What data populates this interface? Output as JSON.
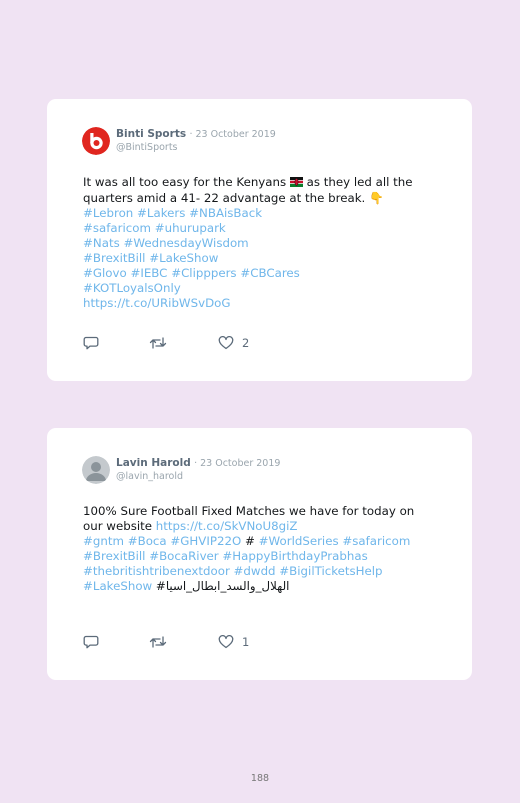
{
  "tweets": [
    {
      "display_name": "Binti Sports",
      "date": "· 23 October 2019",
      "handle": "@BintiSports",
      "avatar_color": "#e0261f",
      "lines": [
        [
          {
            "t": "It was all too easy for the Kenyans "
          },
          {
            "t": "🇰🇪",
            "flag": true
          },
          {
            "t": " as they led all the"
          }
        ],
        [
          {
            "t": "quarters amid a 41- 22 advantage at the break. "
          },
          {
            "t": "👇",
            "emoji": true
          }
        ],
        [
          {
            "t": "#Lebron",
            "link": true
          },
          {
            "t": " "
          },
          {
            "t": "#Lakers",
            "link": true
          },
          {
            "t": " "
          },
          {
            "t": "#NBAisBack",
            "link": true
          }
        ],
        [
          {
            "t": "#safaricom",
            "link": true
          },
          {
            "t": " "
          },
          {
            "t": "#uhurupark",
            "link": true
          }
        ],
        [
          {
            "t": "#Nats",
            "link": true
          },
          {
            "t": " "
          },
          {
            "t": "#WednesdayWisdom",
            "link": true
          }
        ],
        [
          {
            "t": "#BrexitBill",
            "link": true
          },
          {
            "t": " "
          },
          {
            "t": "#LakeShow",
            "link": true
          }
        ],
        [
          {
            "t": "#Glovo",
            "link": true
          },
          {
            "t": " "
          },
          {
            "t": "#IEBC",
            "link": true
          },
          {
            "t": " "
          },
          {
            "t": "#Clipppers",
            "link": true
          },
          {
            "t": " "
          },
          {
            "t": "#CBCares",
            "link": true
          }
        ],
        [
          {
            "t": "#KOTLoyalsOnly",
            "link": true
          }
        ],
        [
          {
            "t": "https://t.co/URibWSvDoG",
            "link": true
          }
        ]
      ],
      "like_count": "2"
    },
    {
      "display_name": "Lavin Harold",
      "date": "· 23 October 2019",
      "handle": "@lavin_harold",
      "avatar_color": "#c4c9cd",
      "lines": [
        [
          {
            "t": "100% Sure Football Fixed Matches we have for today on"
          }
        ],
        [
          {
            "t": "our website "
          },
          {
            "t": "https://t.co/SkVNoU8giZ",
            "link": true
          }
        ],
        [
          {
            "t": " "
          }
        ],
        [
          {
            "t": "#gntm",
            "link": true
          },
          {
            "t": " "
          },
          {
            "t": "#Boca",
            "link": true
          },
          {
            "t": " "
          },
          {
            "t": "#GHVIP22O",
            "link": true
          },
          {
            "t": " # "
          },
          {
            "t": "#WorldSeries",
            "link": true
          },
          {
            "t": " "
          },
          {
            "t": "#safaricom",
            "link": true
          }
        ],
        [
          {
            "t": "#BrexitBill",
            "link": true
          },
          {
            "t": " "
          },
          {
            "t": "#BocaRiver",
            "link": true
          },
          {
            "t": " "
          },
          {
            "t": "#HappyBirthdayPrabhas",
            "link": true
          }
        ],
        [
          {
            "t": "#thebritishtribenextdoor",
            "link": true
          },
          {
            "t": " "
          },
          {
            "t": "#dwdd",
            "link": true
          },
          {
            "t": " "
          },
          {
            "t": "#BigilTicketsHelp",
            "link": true
          }
        ],
        [
          {
            "t": "#LakeShow",
            "link": true
          },
          {
            "t": " #الهلال_والسد_ابطال_اسيا"
          }
        ]
      ],
      "like_count": "1"
    }
  ],
  "page_number": "188",
  "colors": {
    "background": "#f0e3f3",
    "card": "#ffffff",
    "link": "#6fb6ea",
    "text": "#14171a",
    "muted": "#9aa5ad"
  },
  "icons": [
    "reply-icon",
    "retweet-icon",
    "heart-icon"
  ]
}
